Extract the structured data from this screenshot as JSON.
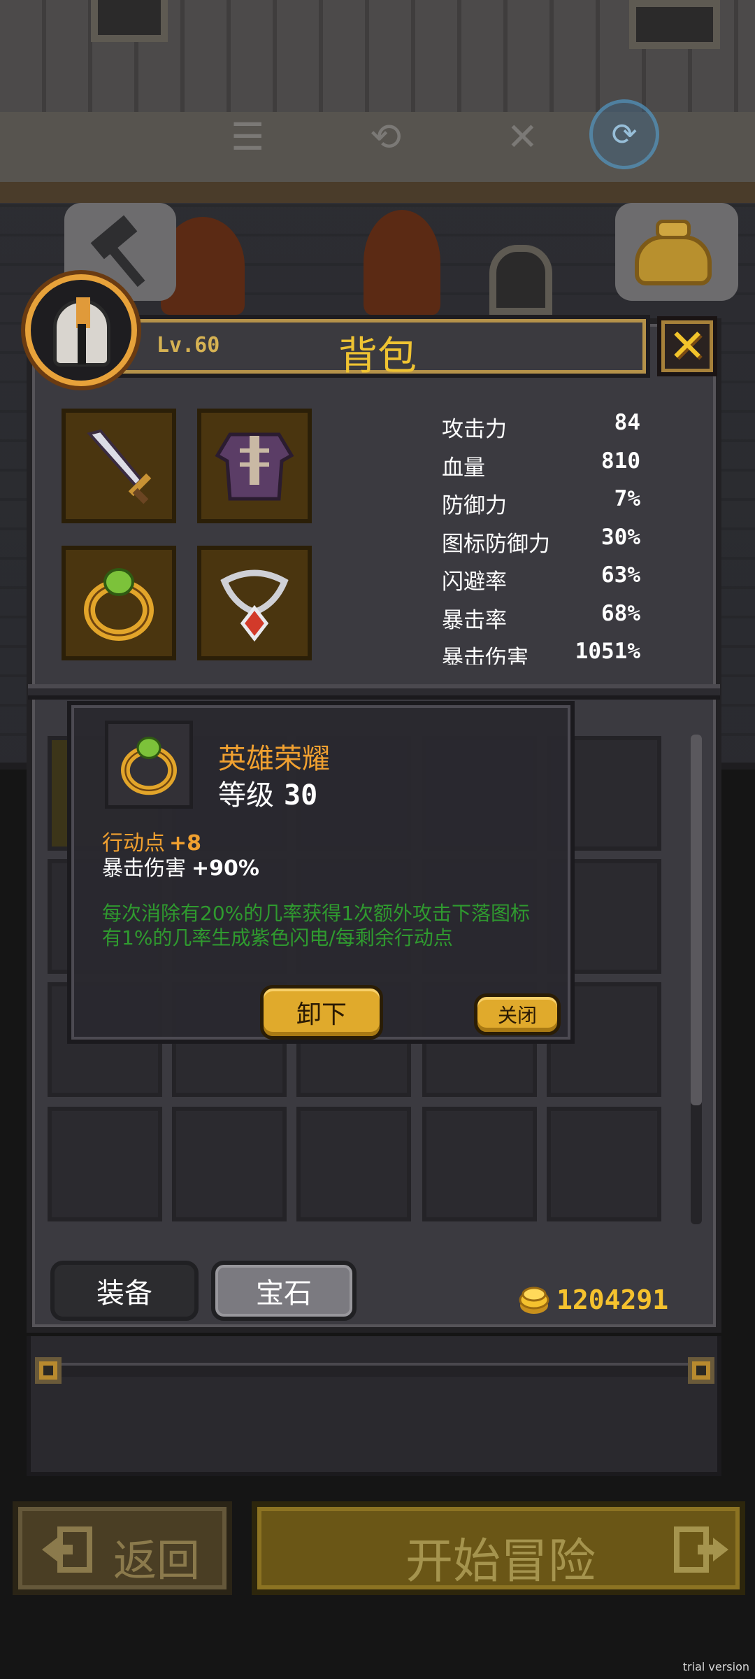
{
  "background": {
    "system_glyphs": [
      "☰",
      "⟲",
      "✕"
    ],
    "system_circle_icon": "⟳"
  },
  "panel": {
    "level": "Lv.60",
    "title": "背包"
  },
  "stats": [
    {
      "label": "攻击力",
      "value": "84"
    },
    {
      "label": "血量",
      "value": "810"
    },
    {
      "label": "防御力",
      "value": "7%"
    },
    {
      "label": "图标防御力",
      "value": "30%"
    },
    {
      "label": "闪避率",
      "value": "63%"
    },
    {
      "label": "暴击率",
      "value": "68%"
    },
    {
      "label": "暴击伤害",
      "value": "1051%"
    }
  ],
  "tooltip": {
    "item_name": "英雄荣耀",
    "level_label": "等级",
    "level_value": "30",
    "attr1_label": "行动点",
    "attr1_value": "+8",
    "attr2_label": "暴击伤害",
    "attr2_value": "+90%",
    "description": "每次消除有20%的几率获得1次额外攻击下落图标有1%的几率生成紫色闪电/每剩余行动点",
    "unequip_button": "卸下",
    "close_button": "关闭"
  },
  "tabs": {
    "equip": "装备",
    "gem": "宝石"
  },
  "gold": "1204291",
  "bottom": {
    "back": "返回",
    "start": "开始冒险"
  },
  "watermark": "trial version",
  "colors": {
    "gold_text": "#efc332",
    "item_name": "#f0a030",
    "effect_text": "#2f9a2f",
    "slot_brown": "#4a350f"
  }
}
